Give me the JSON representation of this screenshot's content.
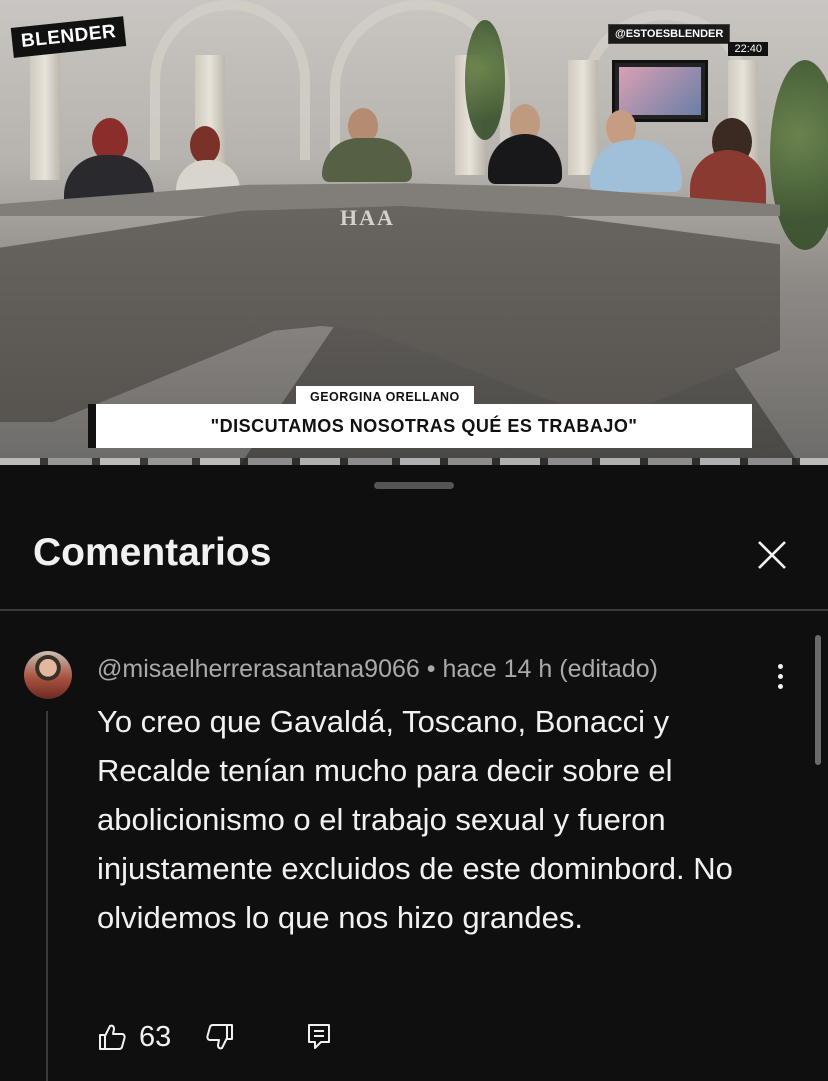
{
  "video": {
    "channel_logo": "BLENDER",
    "handle": "@ESTOESBLENDER",
    "clock": "22:40",
    "set_sign": "HAA",
    "lower_third_name": "GEORGINA ORELLANO",
    "lower_third_quote": "\"DISCUTAMOS NOSOTRAS QUÉ ES TRABAJO\""
  },
  "sheet": {
    "title": "Comentarios",
    "close_icon": "close-icon"
  },
  "comment": {
    "author": "@misaelherrerasantana9066",
    "separator": "•",
    "time": "hace 14 h",
    "edited": "(editado)",
    "text": "Yo creo que Gavaldá, Toscano, Bonacci y Recalde tenían mucho para decir sobre el abolicionismo o el trabajo sexual y fueron injustamente excluidos de este dominbord. No olvidemos lo que nos hizo grandes.",
    "likes": "63",
    "icons": {
      "like": "thumbs-up-icon",
      "dislike": "thumbs-down-icon",
      "reply": "reply-icon",
      "more": "more-vert-icon"
    }
  }
}
